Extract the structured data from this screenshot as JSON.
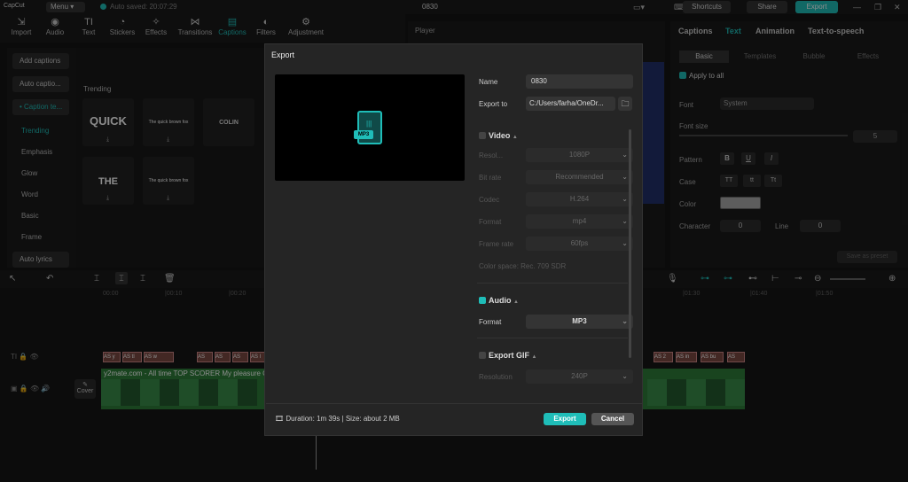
{
  "titlebar": {
    "logo": "CapCut",
    "menu_label": "Menu",
    "autosave": "Auto saved: 20:07:29",
    "project_name": "0830",
    "shortcuts": "Shortcuts",
    "share": "Share",
    "export": "Export"
  },
  "toolbar": {
    "items": [
      {
        "label": "Import",
        "icon": "import-icon"
      },
      {
        "label": "Audio",
        "icon": "audio-icon"
      },
      {
        "label": "Text",
        "icon": "text-icon"
      },
      {
        "label": "Stickers",
        "icon": "stickers-icon"
      },
      {
        "label": "Effects",
        "icon": "effects-icon"
      },
      {
        "label": "Transitions",
        "icon": "transitions-icon"
      },
      {
        "label": "Captions",
        "icon": "captions-icon"
      },
      {
        "label": "Filters",
        "icon": "filters-icon"
      },
      {
        "label": "Adjustment",
        "icon": "adjustment-icon"
      }
    ],
    "active": "Captions"
  },
  "leftnav": {
    "buttons": [
      "Add captions",
      "Auto captio...",
      "• Caption te..."
    ],
    "items": [
      "Trending",
      "Emphasis",
      "Glow",
      "Word",
      "Basic",
      "Frame"
    ],
    "bottom_button": "Auto lyrics"
  },
  "main": {
    "section_title": "Trending",
    "cards": [
      "QUICK",
      "The quick brown fox",
      "COLIN",
      "THE",
      "The quick brown fox"
    ]
  },
  "player": {
    "title": "Player"
  },
  "rightpanel": {
    "tabs": [
      "Captions",
      "Text",
      "Animation",
      "Text-to-speech"
    ],
    "subtabs": [
      "Basic",
      "Templates",
      "Bubble",
      "Effects"
    ],
    "apply_all": "Apply to all",
    "font_label": "Font",
    "font_value": "System",
    "font_size_label": "Font size",
    "font_size_value": "5",
    "pattern_label": "Pattern",
    "pattern_buttons": [
      "B",
      "U",
      "I"
    ],
    "case_label": "Case",
    "case_buttons": [
      "TT",
      "tt",
      "Tt"
    ],
    "color_label": "Color",
    "character_label": "Character",
    "character_value": "0",
    "line_label": "Line",
    "line_value": "0",
    "save_preset": "Save as preset"
  },
  "timeline": {
    "ticks": [
      "00:00",
      "|00:10",
      "|00:20",
      "|01:30",
      "|01:40",
      "|01:50"
    ],
    "cover_label": "Cover",
    "video_label": "y2mate.com - All time TOP SCORER My pleasure Ch",
    "caption_clips": [
      "AS y",
      "AS tl",
      "AS w",
      "AS",
      "AS",
      "AS",
      "AS l",
      "AS 2",
      "AS in",
      "AS bu",
      "AS"
    ]
  },
  "export_dialog": {
    "title": "Export",
    "name_label": "Name",
    "name_value": "0830",
    "export_to_label": "Export to",
    "export_to_value": "C:/Users/farha/OneDr...",
    "file_badge": "MP3",
    "video_section": "Video",
    "resolution_label": "Resol...",
    "resolution_value": "1080P",
    "bitrate_label": "Bit rate",
    "bitrate_value": "Recommended",
    "codec_label": "Codec",
    "codec_value": "H.264",
    "format_label": "Format",
    "format_value": "mp4",
    "framerate_label": "Frame rate",
    "framerate_value": "60fps",
    "colorspace": "Color space: Rec. 709 SDR",
    "audio_section": "Audio",
    "audio_format_label": "Format",
    "audio_format_value": "MP3",
    "gif_section": "Export GIF",
    "gif_resolution_label": "Resolution",
    "gif_resolution_value": "240P",
    "duration_info": "Duration: 1m 39s | Size: about 2 MB",
    "export_button": "Export",
    "cancel_button": "Cancel"
  },
  "colors": {
    "accent": "#1fbdb8",
    "background": "#141414",
    "modal": "#252525"
  }
}
